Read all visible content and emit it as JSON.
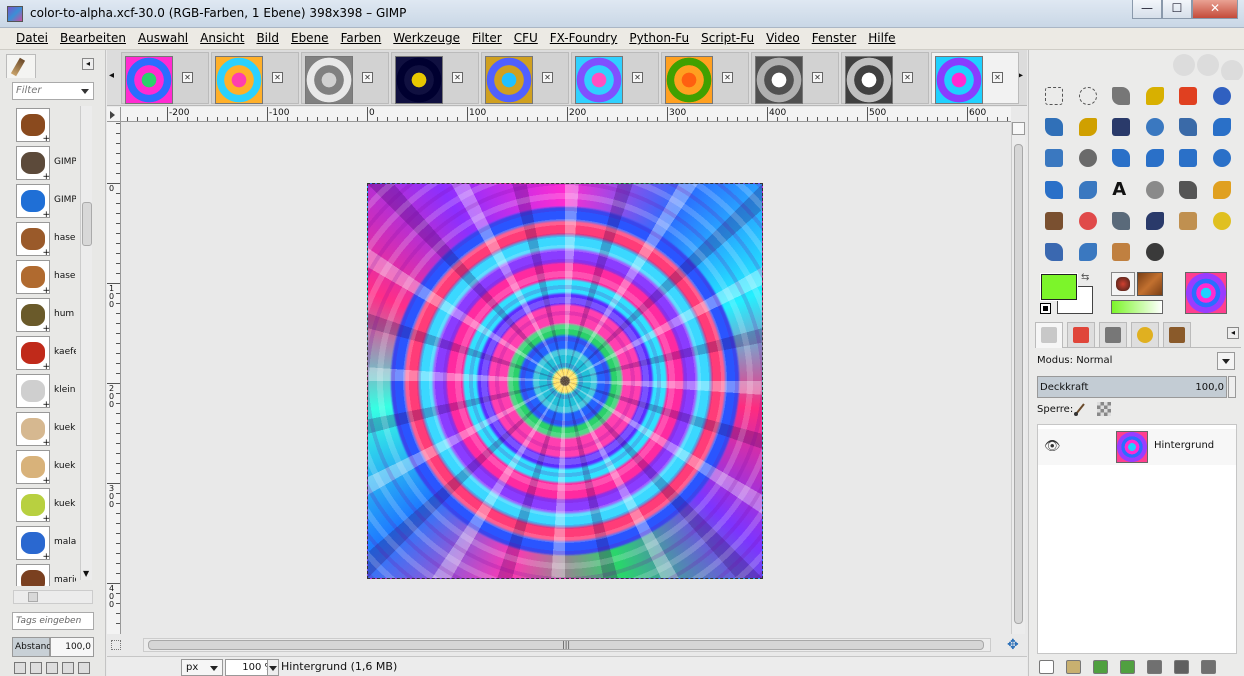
{
  "window": {
    "title": "color-to-alpha.xcf-30.0 (RGB-Farben, 1 Ebene) 398x398 – GIMP",
    "controls": [
      "—",
      "☐",
      "✕"
    ]
  },
  "menubar": [
    {
      "id": "datei",
      "label": "Datei"
    },
    {
      "id": "bearbeiten",
      "label": "Bearbeiten"
    },
    {
      "id": "auswahl",
      "label": "Auswahl"
    },
    {
      "id": "ansicht",
      "label": "Ansicht"
    },
    {
      "id": "bild",
      "label": "Bild"
    },
    {
      "id": "ebene",
      "label": "Ebene"
    },
    {
      "id": "farben",
      "label": "Farben"
    },
    {
      "id": "werkzeuge",
      "label": "Werkzeuge"
    },
    {
      "id": "filter",
      "label": "Filter"
    },
    {
      "id": "cfu",
      "label": "CFU"
    },
    {
      "id": "fx-foundry",
      "label": "FX-Foundry"
    },
    {
      "id": "python-fu",
      "label": "Python-Fu"
    },
    {
      "id": "script-fu",
      "label": "Script-Fu"
    },
    {
      "id": "video",
      "label": "Video"
    },
    {
      "id": "fenster",
      "label": "Fenster"
    },
    {
      "id": "hilfe",
      "label": "Hilfe"
    }
  ],
  "brushes": {
    "filter_placeholder": "Filter",
    "items": [
      {
        "label": "",
        "color": "#8a4a1e"
      },
      {
        "label": "GIMP",
        "color": "#5c4a3a"
      },
      {
        "label": "GIMP",
        "color": "#1f6fd6"
      },
      {
        "label": "hase",
        "color": "#9a5a2a"
      },
      {
        "label": "hase",
        "color": "#b06a2f"
      },
      {
        "label": "hum",
        "color": "#6a5a2a"
      },
      {
        "label": "kaefe",
        "color": "#c02a1a"
      },
      {
        "label": "klein",
        "color": "#cfcfcf"
      },
      {
        "label": "kuek",
        "color": "#d6b890"
      },
      {
        "label": "kuek",
        "color": "#d8b27a"
      },
      {
        "label": "kuek",
        "color": "#b8d040"
      },
      {
        "label": "mala",
        "color": "#2a68d0"
      },
      {
        "label": "marie",
        "color": "#7a4020"
      }
    ],
    "tags_placeholder": "Tags eingeben",
    "spacing_label": "Abstand",
    "spacing_value": "100,0"
  },
  "image_tabs": [
    {
      "id": 1,
      "colors": [
        "#2bd16b",
        "#ff2bd1",
        "#2b6dff"
      ],
      "active": false
    },
    {
      "id": 2,
      "colors": [
        "#ff3fb0",
        "#ffb02a",
        "#2bd1ff"
      ],
      "active": false
    },
    {
      "id": 3,
      "colors": [
        "#d0d0d0",
        "#808080",
        "#e8e8e8"
      ],
      "active": false
    },
    {
      "id": 4,
      "colors": [
        "#e8c800",
        "#101040",
        "#000030"
      ],
      "active": false
    },
    {
      "id": 5,
      "colors": [
        "#20c0ff",
        "#d0a020",
        "#5060ff"
      ],
      "active": false
    },
    {
      "id": 6,
      "colors": [
        "#ff50c0",
        "#30d0ff",
        "#8050ff"
      ],
      "active": false
    },
    {
      "id": 7,
      "colors": [
        "#ff6010",
        "#ffa020",
        "#40a000"
      ],
      "active": false
    },
    {
      "id": 8,
      "colors": [
        "#ffffff",
        "#505050",
        "#b0b0b0"
      ],
      "active": false
    },
    {
      "id": 9,
      "colors": [
        "#ffffff",
        "#404040",
        "#c0c0c0"
      ],
      "active": false
    },
    {
      "id": 10,
      "colors": [
        "#ff2bd1",
        "#20d0ff",
        "#8a3cff"
      ],
      "active": true
    }
  ],
  "rulers": {
    "horizontal": [
      "-200",
      "-100",
      "0",
      "100",
      "200",
      "300",
      "400",
      "500",
      "600"
    ],
    "vertical": [
      "0",
      "100",
      "200",
      "300",
      "400"
    ]
  },
  "statusbar": {
    "unit": "px",
    "zoom": "100 %",
    "text": "Hintergrund (1,6 MB)"
  },
  "toolbox": {
    "tools": [
      {
        "name": "rect-select-icon",
        "color": "#777"
      },
      {
        "name": "ellipse-select-icon",
        "color": "#777"
      },
      {
        "name": "free-select-icon",
        "color": "#777"
      },
      {
        "name": "fuzzy-select-icon",
        "color": "#d8b000"
      },
      {
        "name": "select-by-color-icon",
        "color": "#e04020"
      },
      {
        "name": "scissors-icon",
        "color": "#3060c0"
      },
      {
        "name": "foreground-select-icon",
        "color": "#3070b8"
      },
      {
        "name": "paths-icon",
        "color": "#d0a000"
      },
      {
        "name": "color-picker-icon",
        "color": "#2a3a6a"
      },
      {
        "name": "zoom-icon",
        "color": "#3a78c0"
      },
      {
        "name": "measure-icon",
        "color": "#3a6aa8"
      },
      {
        "name": "move-icon",
        "color": "#2a70c8"
      },
      {
        "name": "align-icon",
        "color": "#3a78c0"
      },
      {
        "name": "crop-icon",
        "color": "#6a6a6a"
      },
      {
        "name": "rotate-icon",
        "color": "#2a70c8"
      },
      {
        "name": "scale-icon",
        "color": "#2a70c8"
      },
      {
        "name": "shear-icon",
        "color": "#2a70c8"
      },
      {
        "name": "perspective-icon",
        "color": "#2a70c8"
      },
      {
        "name": "flip-icon",
        "color": "#2a70c8"
      },
      {
        "name": "cage-icon",
        "color": "#3a78c0"
      },
      {
        "name": "text-icon",
        "color": "#111111"
      },
      {
        "name": "bucket-fill-icon",
        "color": "#8a8a8a"
      },
      {
        "name": "blend-icon",
        "color": "#555555"
      },
      {
        "name": "pencil-icon",
        "color": "#e0a020"
      },
      {
        "name": "paintbrush-icon",
        "color": "#7a5030"
      },
      {
        "name": "eraser-icon",
        "color": "#e04a4a"
      },
      {
        "name": "airbrush-icon",
        "color": "#5a6a7a"
      },
      {
        "name": "ink-icon",
        "color": "#2a3a6a"
      },
      {
        "name": "clone-icon",
        "color": "#c09050"
      },
      {
        "name": "heal-icon",
        "color": "#e0c020"
      },
      {
        "name": "perspective-clone-icon",
        "color": "#3a68b0"
      },
      {
        "name": "blur-icon",
        "color": "#3a78c0"
      },
      {
        "name": "smudge-icon",
        "color": "#c08040"
      },
      {
        "name": "dodge-burn-icon",
        "color": "#3a3a3a"
      }
    ],
    "fg_color": "#7cf52a",
    "bg_color": "#ffffff"
  },
  "layers": {
    "tabs": [
      "layers-icon",
      "channels-icon",
      "paths-tab-icon",
      "undo-icon",
      "brush-tab-icon"
    ],
    "mode_label": "Modus: Normal",
    "opacity_label": "Deckkraft",
    "opacity_value": "100,0",
    "lock_label": "Sperre:",
    "layer_name": "Hintergrund",
    "footer_icons": [
      {
        "name": "new-layer-icon",
        "color": "#ffffff"
      },
      {
        "name": "new-group-icon",
        "color": "#c8b070"
      },
      {
        "name": "raise-layer-icon",
        "color": "#50a040"
      },
      {
        "name": "lower-layer-icon",
        "color": "#50a040"
      },
      {
        "name": "duplicate-layer-icon",
        "color": "#707070"
      },
      {
        "name": "anchor-layer-icon",
        "color": "#606060"
      },
      {
        "name": "delete-layer-icon",
        "color": "#707070"
      }
    ]
  }
}
